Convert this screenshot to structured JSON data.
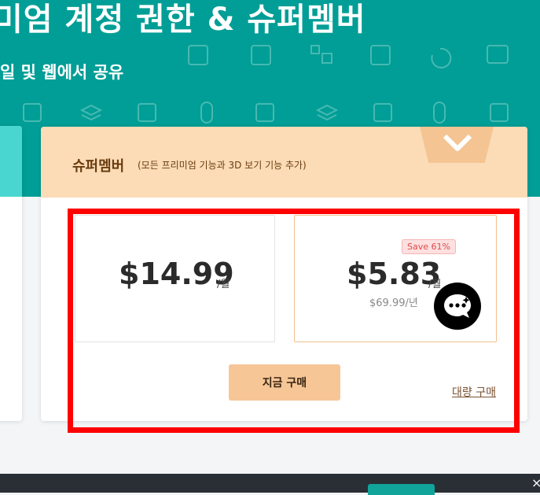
{
  "hero": {
    "title": "미엄 계정 권한 & 슈퍼멤버",
    "subtitle": "일 및 웹에서 공유"
  },
  "plan_card": {
    "title": "슈퍼멤버",
    "note": "(모든 프리미엄 기능과 3D 보기 기능 추가)"
  },
  "plans": {
    "monthly": {
      "price": "$14.99",
      "per": "/월"
    },
    "yearly": {
      "price": "$5.83",
      "per": "/월",
      "save_badge": "Save 61%",
      "total": "$69.99/년"
    }
  },
  "actions": {
    "buy_now": "지금 구매",
    "bulk_purchase": "대량 구매"
  },
  "bottom_bar": {
    "close": "×"
  },
  "colors": {
    "hero_bg": "#009e96",
    "card_header": "#fbdcb6",
    "buy_button": "#f6c697",
    "highlight": "#ff0000"
  }
}
